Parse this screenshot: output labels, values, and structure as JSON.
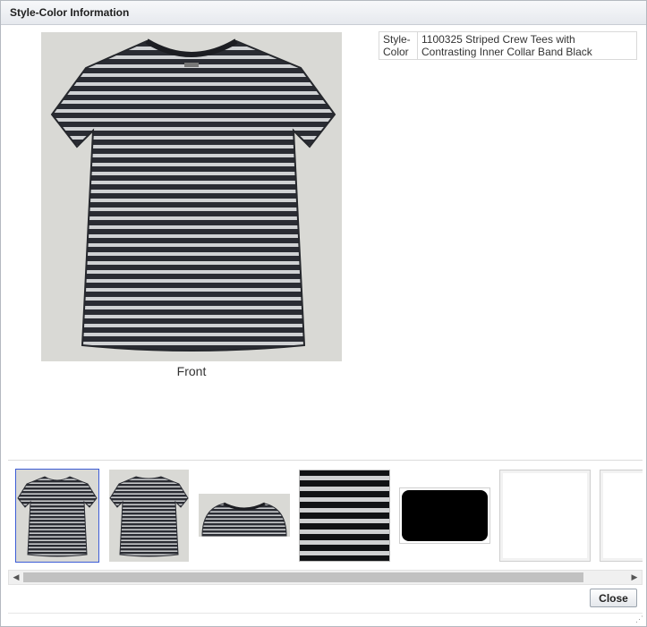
{
  "dialog": {
    "title": "Style-Color Information"
  },
  "main_image": {
    "caption": "Front",
    "icon": "striped-tee-front-image"
  },
  "info": {
    "label": "Style-\nColor",
    "value": "1100325 Striped Crew Tees with Contrasting Inner Collar Band Black"
  },
  "thumbnails": [
    {
      "name": "front",
      "icon": "tee-front-thumbnail",
      "selected": true
    },
    {
      "name": "back",
      "icon": "tee-back-thumbnail",
      "selected": false
    },
    {
      "name": "collar",
      "icon": "collar-detail-thumbnail",
      "selected": false
    },
    {
      "name": "fabric",
      "icon": "fabric-swatch-thumbnail",
      "selected": false
    },
    {
      "name": "color-black",
      "icon": "color-swatch-thumbnail",
      "selected": false
    },
    {
      "name": "blank-1",
      "icon": "blank-thumbnail",
      "selected": false
    },
    {
      "name": "blank-2",
      "icon": "blank-thumbnail",
      "selected": false
    }
  ],
  "scrollbar": {
    "left_arrow": "◀",
    "right_arrow": "▶"
  },
  "buttons": {
    "close_label": "Close"
  },
  "colors": {
    "stripe_dark": "#2a2c33",
    "stripe_light": "#d0d2d4",
    "selection_outline": "#3b5bd6",
    "swatch_black": "#000000"
  }
}
